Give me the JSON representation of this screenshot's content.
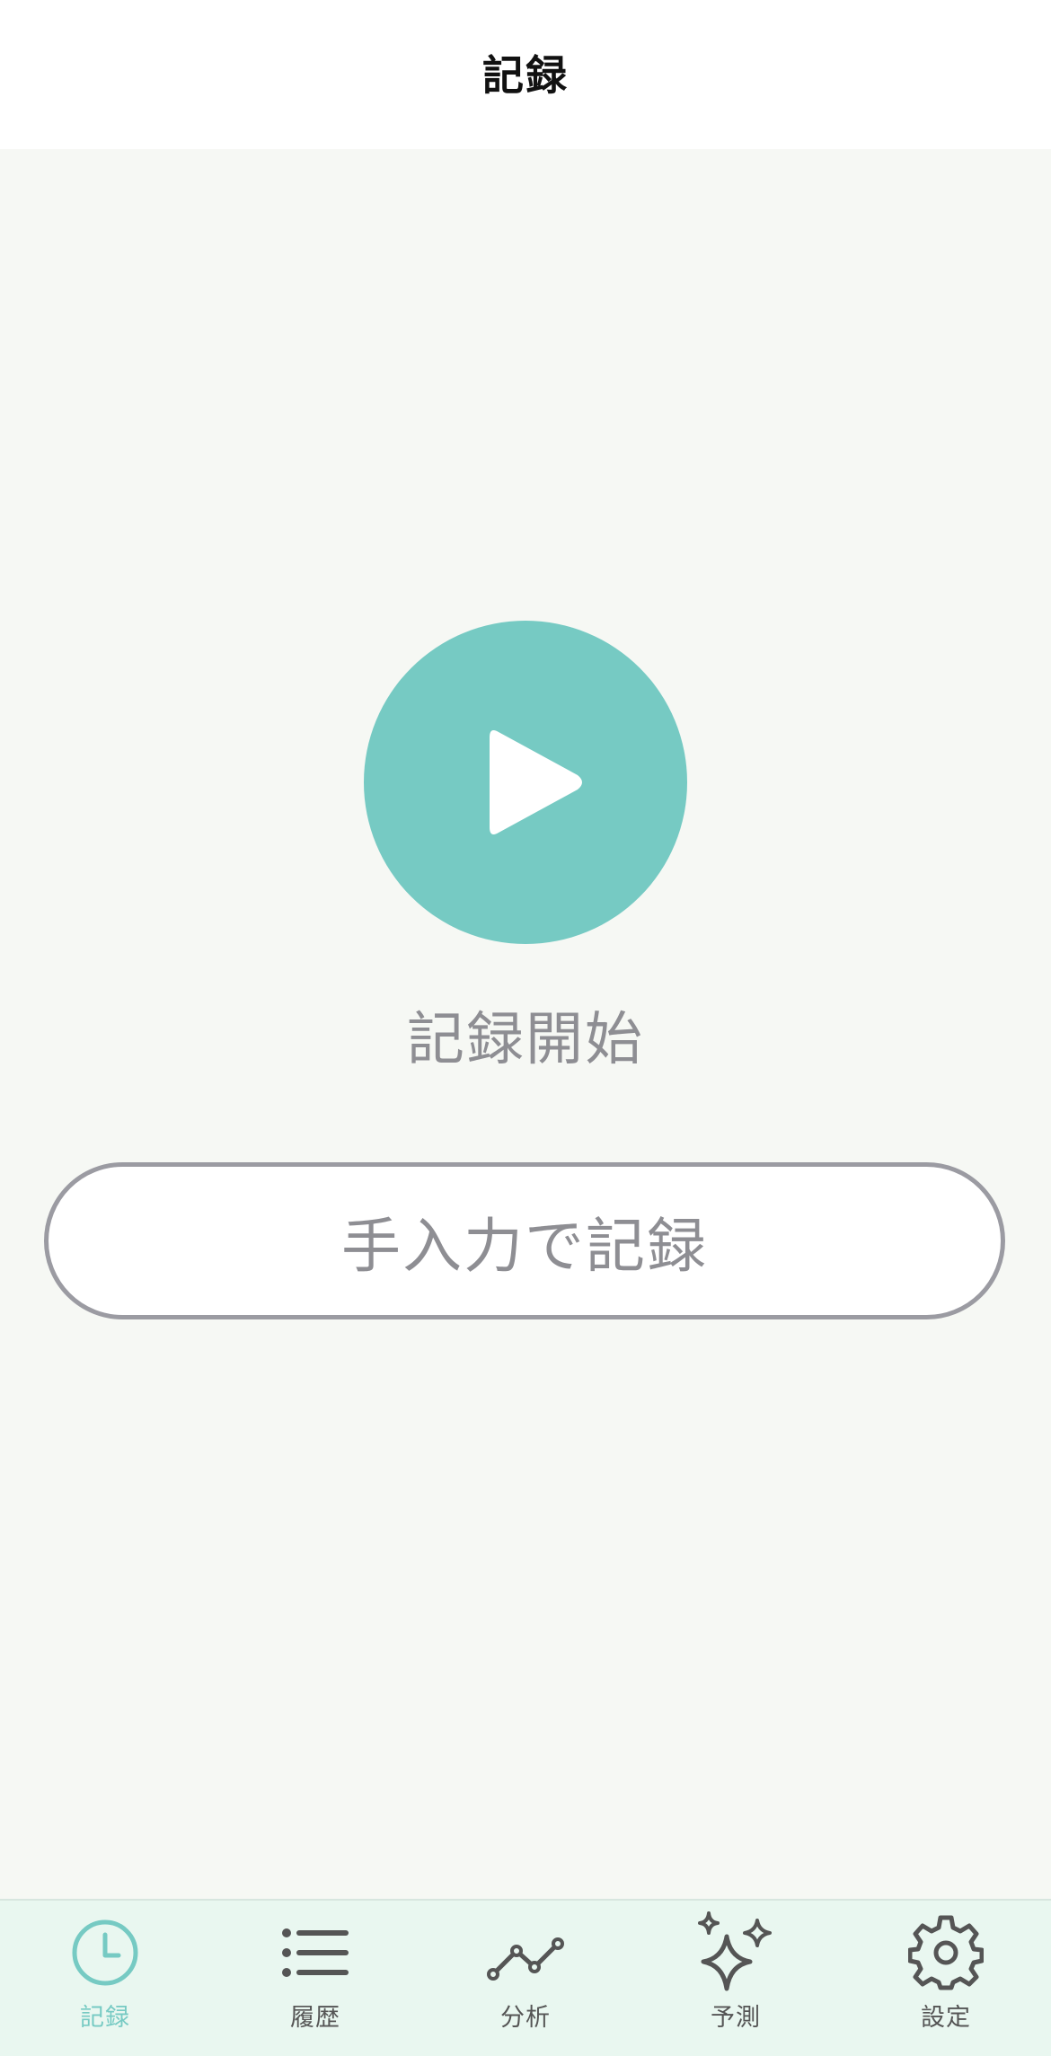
{
  "header": {
    "title": "記録"
  },
  "main": {
    "start_label": "記録開始",
    "manual_label": "手入力で記録"
  },
  "tabs": [
    {
      "label": "記録",
      "icon": "clock-icon",
      "active": true
    },
    {
      "label": "履歴",
      "icon": "list-icon",
      "active": false
    },
    {
      "label": "分析",
      "icon": "line-chart-icon",
      "active": false
    },
    {
      "label": "予測",
      "icon": "sparkles-icon",
      "active": false
    },
    {
      "label": "設定",
      "icon": "gear-icon",
      "active": false
    }
  ],
  "colors": {
    "accent": "#76cac3",
    "background": "#f6f8f4",
    "tabbar": "#e9f7f0",
    "muted_text": "#8e8e93",
    "inactive_icon": "#555555"
  }
}
